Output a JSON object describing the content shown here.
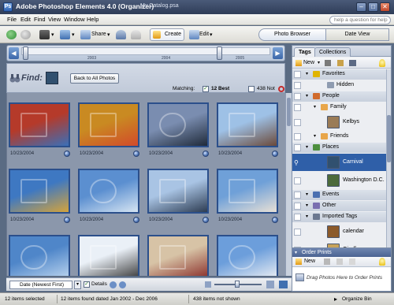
{
  "titlebar": {
    "app_title": "Adobe Photoshop Elements 4.0 (Organizer)",
    "catalog": "My Catalog.psa",
    "logo_letter": "Ps",
    "minimize": "–",
    "maximize": "□",
    "close": "✕"
  },
  "menu": [
    "File",
    "Edit",
    "Find",
    "View",
    "Window",
    "Help"
  ],
  "help": {
    "placeholder": "help a question for help"
  },
  "toolbar": {
    "share_label": "Share",
    "create_label": "Create",
    "edit_label": "Edit",
    "photo_browser_label": "Photo Browser",
    "date_view_label": "Date View"
  },
  "timeline": {
    "years": [
      "2003",
      "2004",
      "2005"
    ]
  },
  "findbar": {
    "find_label": "Find:",
    "back_button": "Back to All Photos",
    "matching_label": "Matching:",
    "best_count": "12 Best",
    "not_count": "438 Not"
  },
  "photos": [
    {
      "date": "10/23/2004",
      "subject": "street-signs",
      "palette": [
        "#b53a2a",
        "#3a6fb8"
      ]
    },
    {
      "date": "10/23/2004",
      "subject": "bus-sign",
      "palette": [
        "#c98a22",
        "#d24a2a"
      ]
    },
    {
      "date": "10/23/2004",
      "subject": "ferris-wheel-dusk",
      "palette": [
        "#7a8db0",
        "#1f2a3a"
      ]
    },
    {
      "date": "10/23/2004",
      "subject": "billboard",
      "palette": [
        "#9ec1e6",
        "#6b4a3a"
      ]
    },
    {
      "date": "10/23/2004",
      "subject": "boardwalk-facade",
      "palette": [
        "#3e78c2",
        "#d4a33c"
      ]
    },
    {
      "date": "10/23/2004",
      "subject": "ride-tower",
      "palette": [
        "#5b8fd0",
        "#d6e4f2"
      ]
    },
    {
      "date": "10/23/2004",
      "subject": "ferris-wheel",
      "palette": [
        "#a9c4e4",
        "#2d3c52"
      ]
    },
    {
      "date": "10/23/2004",
      "subject": "carnival-ride",
      "palette": [
        "#6fa0d8",
        "#e8e0d6"
      ]
    },
    {
      "date": "",
      "subject": "sky-ride",
      "palette": [
        "#4f86c9",
        "#b9d3ee"
      ]
    },
    {
      "date": "",
      "subject": "wheel-closeup",
      "palette": [
        "#eaf0f7",
        "#3b3b3b"
      ]
    },
    {
      "date": "",
      "subject": "tower-lights",
      "palette": [
        "#d7c3a6",
        "#8a2f2a"
      ]
    },
    {
      "date": "",
      "subject": "tall-ride",
      "palette": [
        "#6c9edb",
        "#e9edf3"
      ]
    }
  ],
  "bottombar": {
    "sort": "Date (Newest First)",
    "details_label": "Details"
  },
  "status": {
    "selected": "12 items selected",
    "found": "12 items found dated Jan 2002 - Dec 2006",
    "not_shown": "438 items not shown",
    "organize_bin": "Organize Bin"
  },
  "tags_panel": {
    "tabs": [
      "Tags",
      "Collections"
    ],
    "new_label": "New",
    "rows": [
      {
        "label": "Favorites",
        "kind": "category",
        "color": "#e0b400"
      },
      {
        "label": "Hidden",
        "kind": "tag",
        "color": "#8e9bb0"
      },
      {
        "label": "People",
        "kind": "category",
        "color": "#d06a2c"
      },
      {
        "label": "Family",
        "kind": "subcategory",
        "color": "#e8a64a"
      },
      {
        "label": "Kelbys",
        "kind": "tag",
        "color": "#9a7b56"
      },
      {
        "label": "Friends",
        "kind": "subcategory",
        "color": "#e8a64a"
      },
      {
        "label": "Places",
        "kind": "category",
        "color": "#4d8f3e"
      },
      {
        "label": "Carnival",
        "kind": "tag",
        "color": "#31506f",
        "selected": true
      },
      {
        "label": "Washington D.C.",
        "kind": "tag",
        "color": "#4c6a3a"
      },
      {
        "label": "Events",
        "kind": "category",
        "color": "#4a6fb0"
      },
      {
        "label": "Other",
        "kind": "category",
        "color": "#7a6fb0"
      },
      {
        "label": "Imported Tags",
        "kind": "category",
        "color": "#6b7890"
      },
      {
        "label": "calendar",
        "kind": "tag",
        "color": "#8b5a2b"
      },
      {
        "label": "Giraffes",
        "kind": "tag",
        "color": "#c8a35a"
      }
    ]
  },
  "order_prints": {
    "title": "Order Prints",
    "new_label": "New",
    "drag_hint": "Drag Photos Here to Order Prints"
  }
}
